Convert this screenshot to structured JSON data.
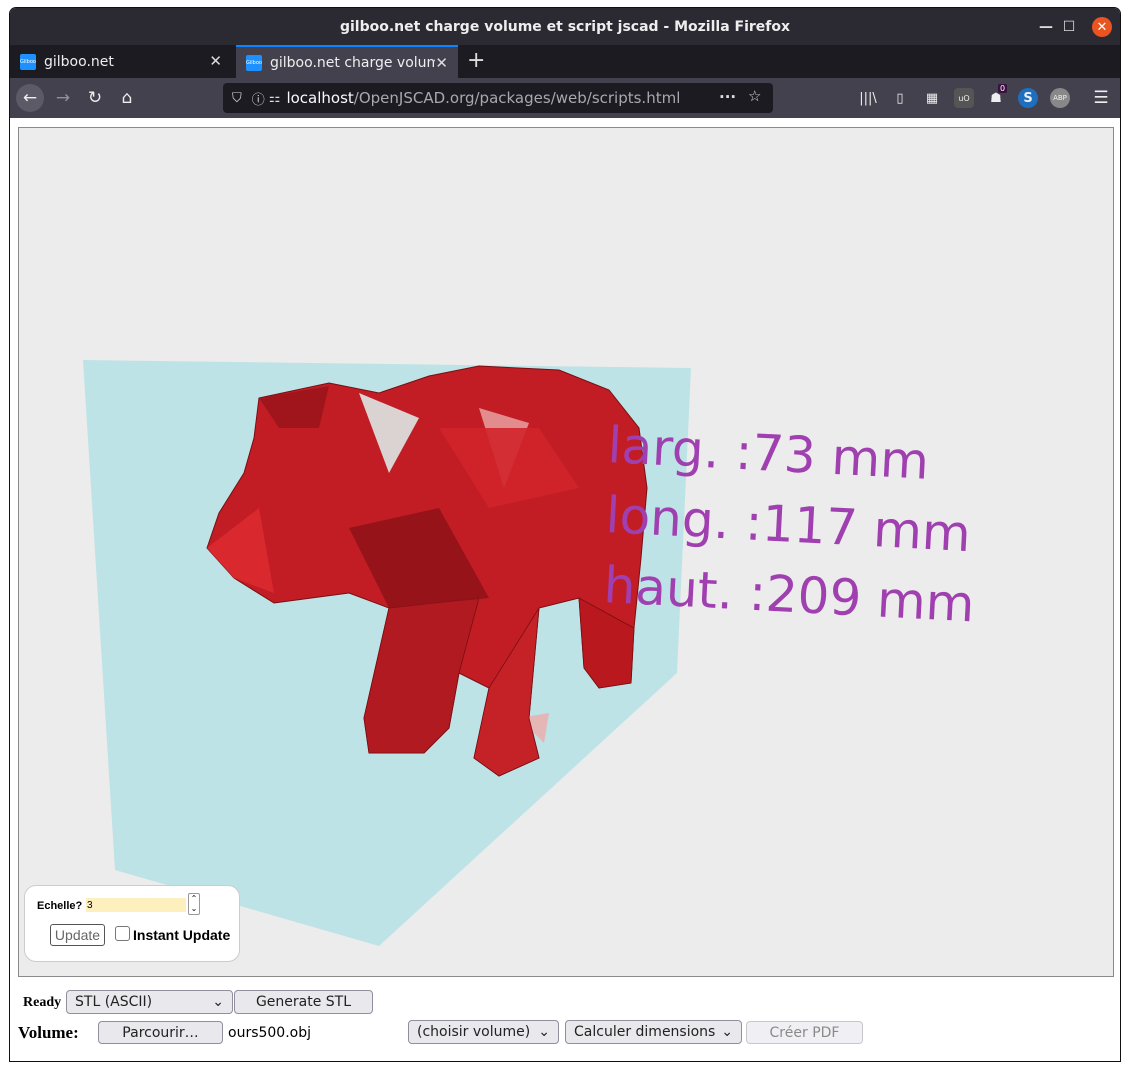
{
  "window": {
    "title": "gilboo.net charge volume et script jscad - Mozilla Firefox"
  },
  "tabs": [
    {
      "label": "gilboo.net",
      "favicon_text": "Gilboo",
      "active": false
    },
    {
      "label": "gilboo.net charge volume et script jscad",
      "favicon_text": "Gilboo",
      "active": true
    }
  ],
  "url": {
    "host": "localhost",
    "path": "/OpenJSCAD.org/packages/web/scripts.html"
  },
  "toolbar": {
    "notification_badge": "0",
    "abp_label": "ABP",
    "ublock_label": "uO"
  },
  "viewer": {
    "dimension_texts": [
      "larg. :73 mm",
      "long. :117 mm",
      "haut. :209 mm"
    ],
    "text_color": "#a040b0",
    "model_color": "#c01e24",
    "bbox_color": "#b8e2e6"
  },
  "params": {
    "label": "Echelle?",
    "value": "3",
    "update_label": "Update",
    "instant_update_label": "Instant Update",
    "instant_update_checked": false
  },
  "status": {
    "ready_label": "Ready",
    "format_selected": "STL (ASCII)",
    "generate_label": "Generate STL"
  },
  "volume": {
    "label": "Volume:",
    "browse_label": "Parcourir…",
    "file_name": "ours500.obj",
    "choose_selected": "(choisir volume)",
    "calc_selected": "Calculer dimensions",
    "pdf_label": "Créer PDF"
  }
}
